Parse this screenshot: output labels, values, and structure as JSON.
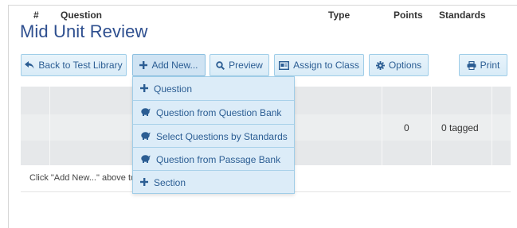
{
  "page": {
    "title": "Mid Unit Review"
  },
  "toolbar": {
    "back_label": "Back to Test Library",
    "add_new_label": "Add New...",
    "preview_label": "Preview",
    "assign_label": "Assign to Class",
    "options_label": "Options",
    "print_label": "Print"
  },
  "add_menu": {
    "items": [
      {
        "label": "Question",
        "icon": "plus-icon"
      },
      {
        "label": "Question from Question Bank",
        "icon": "piggy-bank-icon"
      },
      {
        "label": "Select Questions by Standards",
        "icon": "piggy-bank-icon"
      },
      {
        "label": "Question from Passage Bank",
        "icon": "piggy-bank-icon"
      },
      {
        "label": "Section",
        "icon": "plus-icon"
      }
    ]
  },
  "table": {
    "headers": {
      "num": "#",
      "question": "Question",
      "type": "Type",
      "points": "Points",
      "standards": "Standards"
    },
    "rows": [
      {
        "points": "0",
        "standards": "0 tagged"
      }
    ],
    "empty_hint": "Click \"Add New...\" above to"
  },
  "colors": {
    "title": "#2e4f8f",
    "button_text": "#2b5d93",
    "button_border": "#9fcde8",
    "menu_bg": "#dcecf8"
  }
}
